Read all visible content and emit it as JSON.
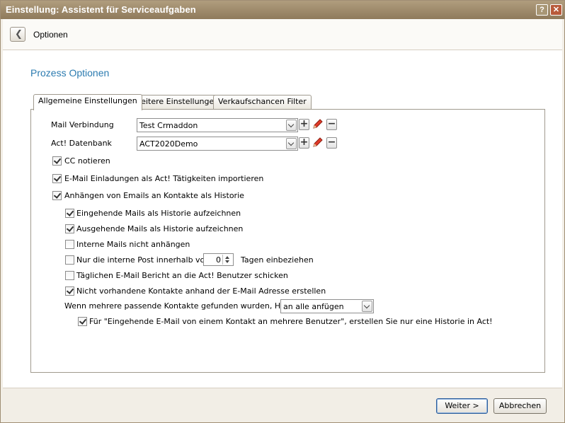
{
  "window": {
    "title": "Einstellung: Assistent für Serviceaufgaben",
    "help_label": "?",
    "close_label": "✕"
  },
  "nav": {
    "back_icon": "chevron-left-icon",
    "title": "Optionen"
  },
  "section_title": "Prozess Optionen",
  "tabs": [
    {
      "label": "Allgemeine Einstellungen",
      "active": true
    },
    {
      "label": "Weitere Einstellungen",
      "active": false
    },
    {
      "label": "Verkaufschancen Filter",
      "active": false
    }
  ],
  "fields": {
    "mail": {
      "label": "Mail Verbindung",
      "value": "Test Crmaddon"
    },
    "db": {
      "label": "Act! Datenbank",
      "value": "ACT2020Demo"
    },
    "add_label": "+",
    "remove_label": "−"
  },
  "checkboxes": {
    "cc": {
      "label": "CC notieren",
      "checked": true
    },
    "invites": {
      "label": "E-Mail Einladungen als Act! Tätigkeiten importieren",
      "checked": true
    },
    "attach": {
      "label": "Anhängen von Emails an Kontakte als Historie",
      "checked": true
    },
    "incoming": {
      "label": "Eingehende Mails als Historie aufzeichnen",
      "checked": true
    },
    "outgoing": {
      "label": "Ausgehende Mails als Historie aufzeichnen",
      "checked": true
    },
    "internal": {
      "label": "Interne Mails nicht anhängen",
      "checked": false
    },
    "only_internal": {
      "label": "Nur die interne Post innerhalb von",
      "checked": false,
      "days_value": "0",
      "suffix": "Tagen einbeziehen"
    },
    "daily": {
      "label": "Täglichen E-Mail Bericht an die Act! Benutzer schicken",
      "checked": false
    },
    "create": {
      "label": "Nicht vorhandene Kontakte anhand der E-Mail Adresse erstellen",
      "checked": true
    },
    "single_history": {
      "label": "Für \"Eingehende E-Mail von einem Kontakt an mehrere Benutzer\", erstellen Sie nur eine Historie in Act!",
      "checked": true
    }
  },
  "multiple": {
    "label": "Wenn mehrere passende Kontakte gefunden wurden, Historie",
    "value": "an alle anfügen"
  },
  "footer": {
    "next_label": "Weiter >",
    "cancel_label": "Abbrechen"
  }
}
